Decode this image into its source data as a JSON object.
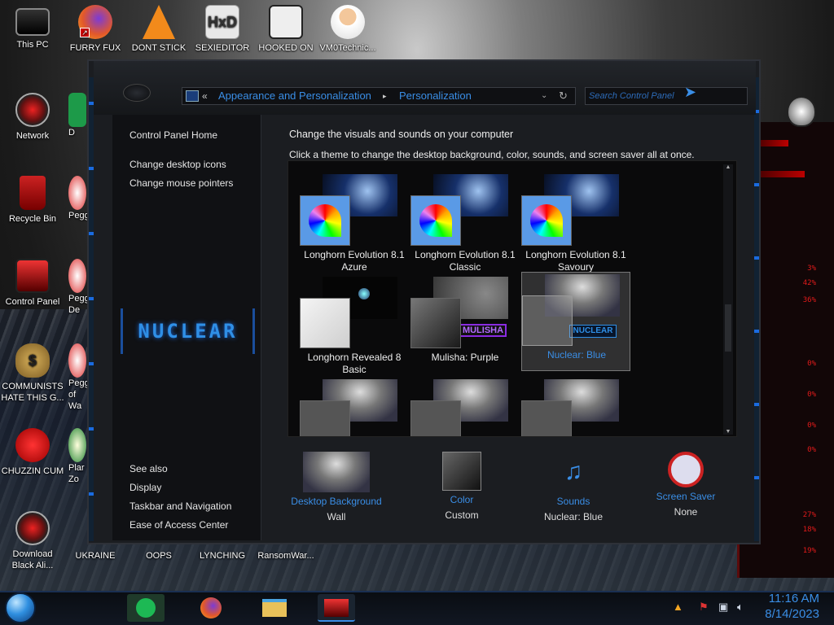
{
  "desktop": {
    "icons": [
      {
        "label": "This PC"
      },
      {
        "label": "FURRY FUX"
      },
      {
        "label": "DONT STICK"
      },
      {
        "label": "SEXIEDITOR"
      },
      {
        "label": "HOOKED ON"
      },
      {
        "label": "VM0Technic..."
      },
      {
        "label": "Network"
      },
      {
        "label": "Recycle Bin"
      },
      {
        "label": "Control Panel"
      },
      {
        "label": "COMMUNISTS HATE THIS G..."
      },
      {
        "label": "CHUZZIN CUM"
      },
      {
        "label": "Download Black Ali..."
      },
      {
        "label": "UKRAINE"
      },
      {
        "label": "OOPS"
      },
      {
        "label": "LYNCHING"
      },
      {
        "label": "RansomWar..."
      }
    ],
    "partial_labels": [
      "D",
      "DUM",
      "Peggl",
      "Peggl De",
      "Peggl of Wa",
      "Plar Zo"
    ]
  },
  "window": {
    "address": {
      "crumb1": "Appearance and Personalization",
      "crumb2": "Personalization",
      "sep": "«",
      "arrow": "»"
    },
    "search_placeholder": "Search Control Panel",
    "sidebar": {
      "home": "Control Panel Home",
      "links": [
        "Change desktop icons",
        "Change mouse pointers"
      ],
      "logo_text": "NUCLEAR",
      "see_also": "See also",
      "see_also_links": [
        "Display",
        "Taskbar and Navigation",
        "Ease of Access Center"
      ]
    },
    "main": {
      "title": "Change the visuals and sounds on your computer",
      "subtitle": "Click a theme to change the desktop background, color, sounds, and screen saver all at once.",
      "themes": [
        {
          "name": "Longhorn Evolution 8.1 Azure"
        },
        {
          "name": "Longhorn Evolution 8.1 Classic"
        },
        {
          "name": "Longhorn Evolution 8.1 Savoury"
        },
        {
          "name": "Longhorn Revealed 8 Basic"
        },
        {
          "name": "Mulisha: Purple",
          "badge": "MULISHA"
        },
        {
          "name": "Nuclear: Blue",
          "badge": "NUCLEAR",
          "selected": true
        }
      ],
      "options": [
        {
          "title": "Desktop Background",
          "value": "Wall"
        },
        {
          "title": "Color",
          "value": "Custom"
        },
        {
          "title": "Sounds",
          "value": "Nuclear: Blue"
        },
        {
          "title": "Screen Saver",
          "value": "None"
        }
      ]
    }
  },
  "widget": {
    "stats": [
      "3%",
      "42%",
      "36%",
      "0%",
      "0%",
      "0%",
      "0%",
      "27%",
      "18%",
      "19%"
    ]
  },
  "clock": {
    "time": "11:16 AM",
    "date": "8/14/2023"
  },
  "colors": {
    "accent": "#3a8ee6",
    "alien_red": "#e21b1b",
    "panel_bg": "#1b1d21"
  }
}
